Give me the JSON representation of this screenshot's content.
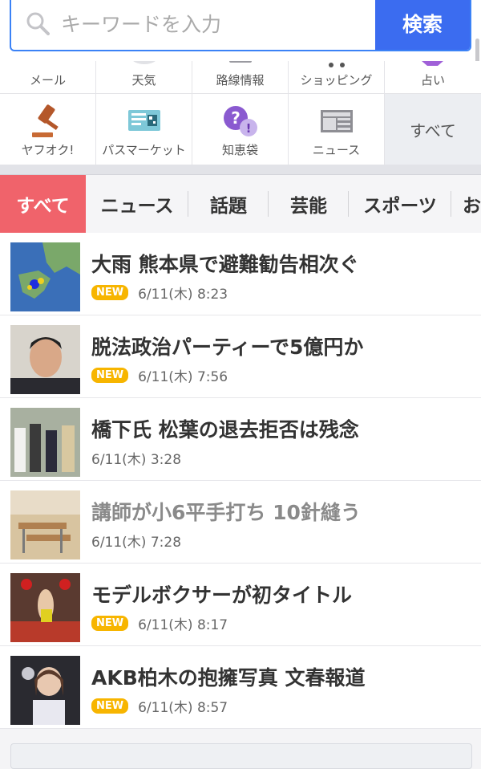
{
  "search": {
    "placeholder": "キーワードを入力",
    "button": "検索"
  },
  "services_row1": [
    "メール",
    "天気",
    "路線情報",
    "ショッピング",
    "占い"
  ],
  "services_row2": [
    "ヤフオク!",
    "パスマーケット",
    "知恵袋",
    "ニュース"
  ],
  "services_all": "すべて",
  "tabs": [
    "すべて",
    "ニュース",
    "話題",
    "芸能",
    "スポーツ",
    "お"
  ],
  "news": [
    {
      "title": "大雨 熊本県で避難勧告相次ぐ",
      "badge": "NEW",
      "time": "6/11(木) 8:23",
      "visited": false
    },
    {
      "title": "脱法政治パーティーで5億円か",
      "badge": "NEW",
      "time": "6/11(木) 7:56",
      "visited": false
    },
    {
      "title": "橋下氏 松葉の退去拒否は残念",
      "badge": "",
      "time": "6/11(木) 3:28",
      "visited": false
    },
    {
      "title": "講師が小6平手打ち 10針縫う",
      "badge": "",
      "time": "6/11(木) 7:28",
      "visited": true
    },
    {
      "title": "モデルボクサーが初タイトル",
      "badge": "NEW",
      "time": "6/11(木) 8:17",
      "visited": false
    },
    {
      "title": "AKB柏木の抱擁写真 文春報道",
      "badge": "NEW",
      "time": "6/11(木) 8:57",
      "visited": false
    }
  ],
  "colors": {
    "accent": "#3b6cf0",
    "active_tab": "#f0636b",
    "badge": "#f7b500"
  }
}
